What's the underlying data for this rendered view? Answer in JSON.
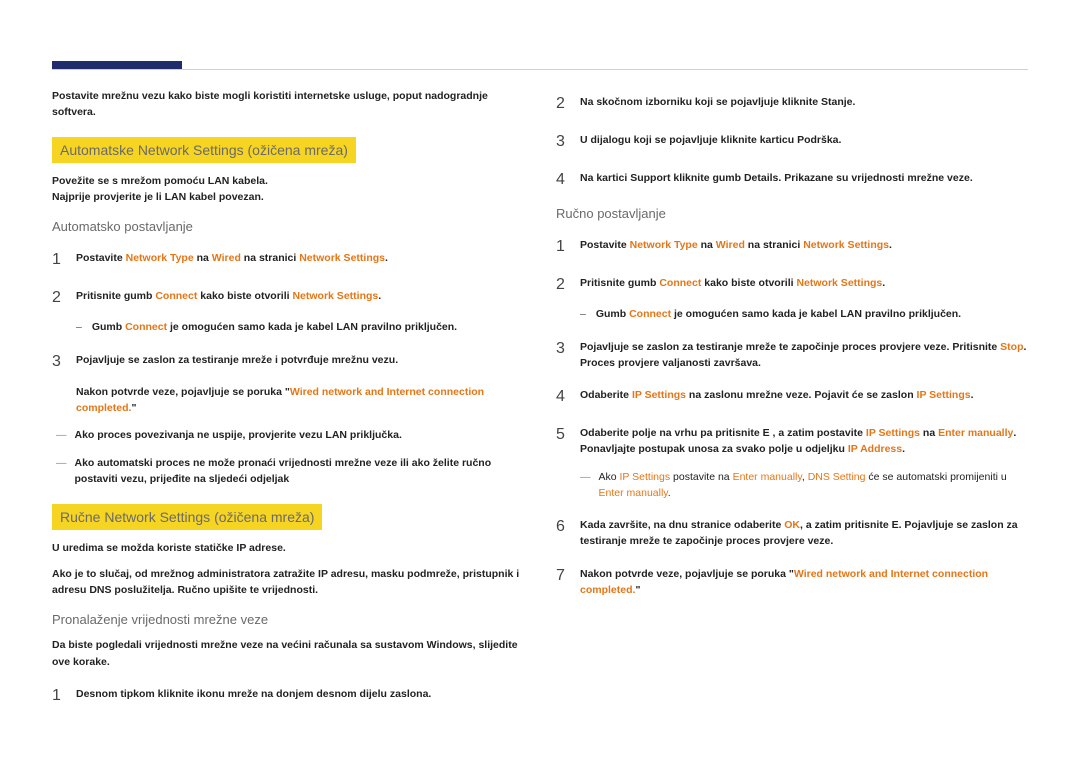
{
  "col1": {
    "intro": "Postavite mrežnu vezu kako biste mogli koristiti internetske usluge, poput nadogradnje softvera.",
    "h_auto": "Automatske Network Settings (ožičena mreža)",
    "auto_p1": "Povežite se s mrežom pomoću LAN kabela.",
    "auto_p2": "Najprije provjerite je li LAN kabel povezan.",
    "sub_auto": "Automatsko postavljanje",
    "s1_a": "Postavite ",
    "s1_b": "Network Type",
    "s1_c": " na ",
    "s1_d": "Wired",
    "s1_e": " na stranici ",
    "s1_f": "Network Settings",
    "s1_g": ".",
    "s2_a": "Pritisnite gumb ",
    "s2_b": "Connect",
    "s2_c": " kako biste otvorili ",
    "s2_d": "Network Settings",
    "s2_e": ".",
    "s2_dash_a": "Gumb ",
    "s2_dash_b": "Connect",
    "s2_dash_c": " je omogućen samo kada je kabel LAN pravilno priključen.",
    "s3": "Pojavljuje se zaslon za testiranje mreže i potvrđuje mrežnu vezu.",
    "s3_post_a": "Nakon potvrde veze, pojavljuje se poruka \"",
    "s3_post_b": "Wired network and Internet connection completed.",
    "s3_post_c": "\"",
    "note1": "Ako proces povezivanja ne uspije, provjerite vezu LAN priključka.",
    "note2": "Ako automatski proces ne može pronaći vrijednosti mrežne veze ili ako želite ručno postaviti vezu, prijeđite na sljedeći odjeljak",
    "h_man": "Ručne Network Settings (ožičena mreža)",
    "man_p1": "U uredima se možda koriste statičke IP adrese.",
    "man_p2": "Ako je to slučaj, od mrežnog administratora zatražite IP adresu, masku podmreže, pristupnik i adresu DNS poslužitelja. Ručno upišite te vrijednosti.",
    "sub_find": "Pronalaženje vrijednosti mrežne veze",
    "find_intro": "Da biste pogledali vrijednosti mrežne veze na većini računala sa sustavom Windows, slijedite ove korake.",
    "find_s1": "Desnom tipkom kliknite ikonu mreže na donjem desnom dijelu zaslona."
  },
  "col2": {
    "s2": "Na skočnom izborniku koji se pojavljuje kliknite Stanje.",
    "s3_a": "U dijalogu koji se pojavljuje kliknite karticu ",
    "s3_b": "Podrška",
    "s3_c": ".",
    "s4_a": "Na kartici ",
    "s4_b": "Support",
    "s4_c": " kliknite gumb ",
    "s4_d": "Details",
    "s4_e": ". Prikazane su vrijednosti mrežne veze.",
    "sub_man": "Ručno postavljanje",
    "ss1_a": "Postavite ",
    "ss1_b": "Network Type",
    "ss1_c": " na ",
    "ss1_d": "Wired",
    "ss1_e": " na stranici ",
    "ss1_f": "Network Settings",
    "ss1_g": ".",
    "ss2_a": "Pritisnite gumb ",
    "ss2_b": "Connect",
    "ss2_c": " kako biste otvorili ",
    "ss2_d": "Network Settings",
    "ss2_e": ".",
    "ss2_dash_a": "Gumb ",
    "ss2_dash_b": "Connect",
    "ss2_dash_c": " je omogućen samo kada je kabel LAN pravilno priključen.",
    "ss3_a": "Pojavljuje se zaslon za testiranje mreže te započinje proces provjere veze. Pritisnite ",
    "ss3_b": ". Proces provjere valjanosti završava.",
    "ss4_a": "Odaberite ",
    "ss4_b": "IP Settings",
    "ss4_c": " na zaslonu mrežne veze. Pojavit će se zaslon ",
    "ss4_d": "IP Settings",
    "ss4_e": ".",
    "ss5_a": "Odaberite polje na vrhu pa pritisnite E    , a zatim postavite ",
    "ss5_b": "IP Settings",
    "ss5_c": " na ",
    "ss5_d": "Enter manually",
    "ss5_e": ". Ponavljajte postupak unosa za svako polje u odjeljku ",
    "ss5_f": "IP Address",
    "ss5_g": ".",
    "note_a": "Ako ",
    "note_b": "IP Settings",
    "note_c": " postavite na ",
    "note_d": "Enter manually",
    "note_e": ", ",
    "note_f": "DNS Setting",
    "note_g": " će se automatski promijeniti u ",
    "note_h": "Enter manually",
    "note_i": ".",
    "ss6_a": "Kada završite, na dnu stranice odaberite ",
    "ss6_b": "OK",
    "ss6_c": ", a zatim pritisnite E. Pojavljuje se zaslon za testiranje mreže te započinje proces provjere veze.",
    "ss7_a": "Nakon potvrde veze, pojavljuje se poruka \"",
    "ss7_b": "Wired network and Internet connection completed.",
    "ss7_c": "\""
  }
}
